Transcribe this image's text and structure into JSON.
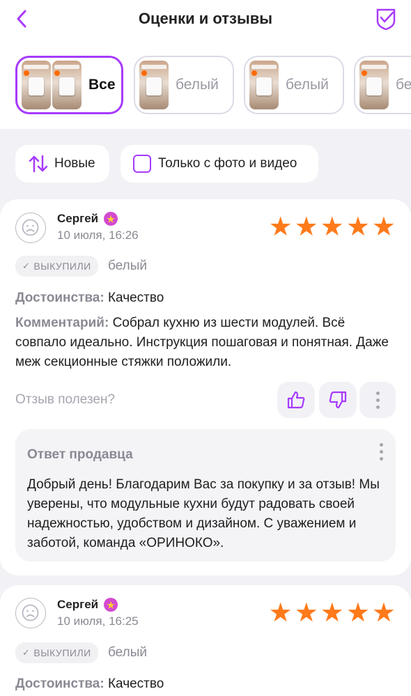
{
  "header": {
    "title": "Оценки и отзывы"
  },
  "variants": [
    {
      "label": "Все",
      "active": true
    },
    {
      "label": "белый",
      "active": false
    },
    {
      "label": "белый",
      "active": false
    },
    {
      "label": "бе",
      "active": false
    }
  ],
  "filters": {
    "sort_label": "Новые",
    "photo_label": "Только с фото и видео",
    "photo_checked": false
  },
  "reviews": [
    {
      "author": "Сергей",
      "date": "10 июля, 16:26",
      "rating": 5,
      "bought_label": "ВЫКУПИЛИ",
      "color": "белый",
      "pros_key": "Достоинства:",
      "pros": "Качество",
      "comment_key": "Комментарий:",
      "comment": "Собрал кухню из шести модулей. Всё совпало идеально. Инструкция пошаговая и понятная. Даже меж секционные стяжки положили.",
      "helpful_label": "Отзыв полезен?",
      "reply_title": "Ответ продавца",
      "reply_text": "Добрый день! Благодарим Вас за покупку и за отзыв! Мы уверены, что  модульные кухни будут радовать своей надежностью, удобством и дизайном. С уважением и заботой, команда «ОРИНОКО»."
    },
    {
      "author": "Сергей",
      "date": "10 июля, 16:25",
      "rating": 5,
      "bought_label": "ВЫКУПИЛИ",
      "color": "белый",
      "pros_key": "Достоинства:",
      "pros": "Качество"
    }
  ],
  "colors": {
    "accent": "#a73afd",
    "star": "#ff7a1a",
    "badge": "#d24ad0"
  }
}
